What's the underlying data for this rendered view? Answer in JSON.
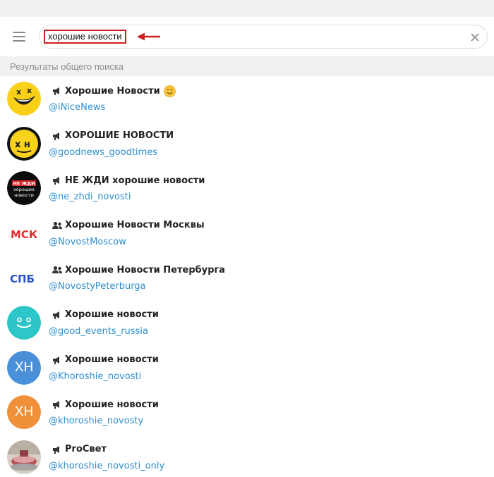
{
  "header": {
    "menu_icon": "hamburger-menu-icon",
    "search_value": "хорошие новости",
    "clear_icon": "close-icon",
    "annotation_color": "#cc1f1f"
  },
  "section_label": "Результаты общего поиска",
  "results": [
    {
      "type": "channel",
      "title": "Хорошие Новости",
      "handle": "@iNiceNews",
      "emoji": "smiling-face-emoji",
      "avatar": "yellow-laughing-face"
    },
    {
      "type": "channel",
      "title": "ХОРОШИЕ НОВОСТИ",
      "handle": "@goodnews_goodtimes",
      "avatar": "yellow-xh-face"
    },
    {
      "type": "channel",
      "title": "НЕ ЖДИ хорошие новости",
      "handle": "@ne_zhdi_novosti",
      "avatar": "black-logo",
      "avatar_text": [
        "НЕ ЖДИ",
        "хорошие",
        "новости"
      ]
    },
    {
      "type": "group",
      "title": "Хорошие Новости Москвы",
      "handle": "@NovostMoscow",
      "avatar": "msk-logo",
      "avatar_text": "МСК"
    },
    {
      "type": "group",
      "title": "Хорошие Новости Петербурга",
      "handle": "@NovostyPeterburga",
      "avatar": "spb-logo",
      "avatar_text": "СПБ"
    },
    {
      "type": "channel",
      "title": "Хорошие новости",
      "handle": "@good_events_russia",
      "avatar": "teal-smiley"
    },
    {
      "type": "channel",
      "title": "Хорошие новости",
      "handle": "@Khoroshie_novosti",
      "avatar": "initials",
      "avatar_text": "ХН",
      "avatar_color": "#4a90d9"
    },
    {
      "type": "channel",
      "title": "Хорошие новости",
      "handle": "@khoroshie_novosty",
      "avatar": "initials",
      "avatar_text": "ХН",
      "avatar_color": "#f0913a"
    },
    {
      "type": "channel",
      "title": "ProСвет",
      "handle": "@khoroshie_novosti_only",
      "avatar": "photo"
    }
  ]
}
